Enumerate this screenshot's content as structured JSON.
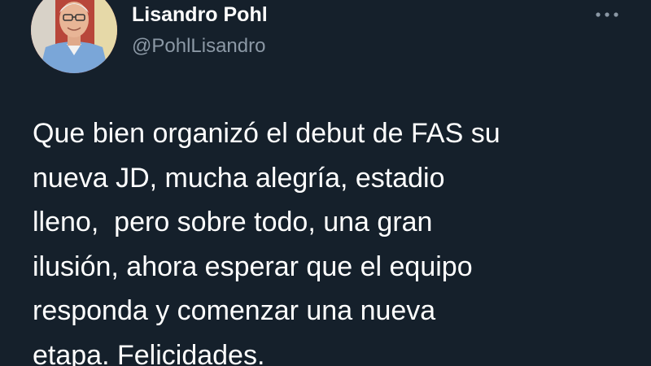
{
  "tweet": {
    "author": {
      "display_name": "Lisandro Pohl",
      "handle": "@PohlLisandro",
      "avatar_icon": "profile-photo"
    },
    "more_icon": "more-horizontal-icon",
    "body": "Que bien organizó el debut de FAS su\nnueva JD, mucha alegría, estadio\nlleno,  pero sobre todo, una gran\nilusión, ahora esperar que el equipo\nresponda y comenzar una nueva\netapa. Felicidades."
  },
  "colors": {
    "background": "#15202b",
    "primary_text": "#ffffff",
    "secondary_text": "#8b98a5"
  }
}
